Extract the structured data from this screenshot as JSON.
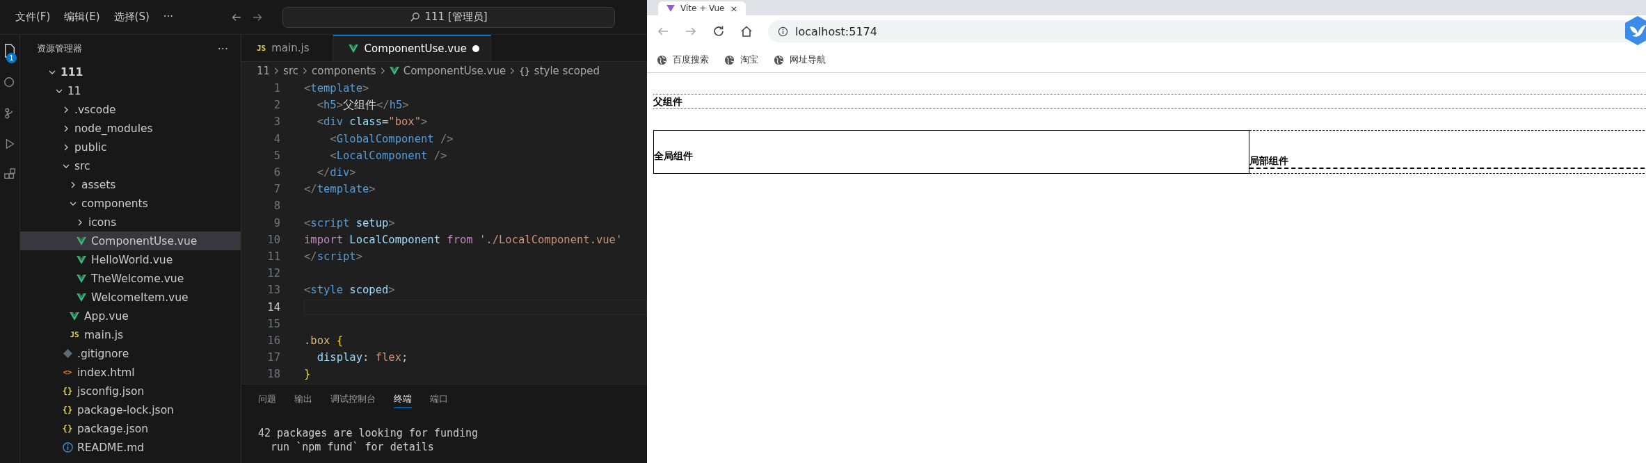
{
  "editor": {
    "menu": [
      "文件(F)",
      "编辑(E)",
      "选择(S)",
      "···"
    ],
    "command_center": "111 [管理员]",
    "explorer_badge": "1",
    "explorer": {
      "title": "资源管理器",
      "more": "···",
      "tree": [
        {
          "label": "111",
          "kind": "folder",
          "expanded": true,
          "selected": false,
          "children": [
            {
              "label": "11",
              "kind": "folder",
              "expanded": true,
              "selected": false,
              "children": [
                {
                  "label": ".vscode",
                  "kind": "folder",
                  "expanded": false,
                  "selected": false
                },
                {
                  "label": "node_modules",
                  "kind": "folder",
                  "expanded": false,
                  "selected": false
                },
                {
                  "label": "public",
                  "kind": "folder",
                  "expanded": false,
                  "selected": false
                },
                {
                  "label": "src",
                  "kind": "folder",
                  "expanded": true,
                  "selected": false,
                  "children": [
                    {
                      "label": "assets",
                      "kind": "folder",
                      "expanded": false,
                      "selected": false
                    },
                    {
                      "label": "components",
                      "kind": "folder",
                      "expanded": true,
                      "selected": false,
                      "children": [
                        {
                          "label": "icons",
                          "kind": "folder",
                          "expanded": false,
                          "selected": false
                        },
                        {
                          "label": "ComponentUse.vue",
                          "kind": "vue",
                          "selected": true
                        },
                        {
                          "label": "HelloWorld.vue",
                          "kind": "vue",
                          "selected": false
                        },
                        {
                          "label": "TheWelcome.vue",
                          "kind": "vue",
                          "selected": false
                        },
                        {
                          "label": "WelcomeItem.vue",
                          "kind": "vue",
                          "selected": false
                        }
                      ]
                    },
                    {
                      "label": "App.vue",
                      "kind": "vue",
                      "selected": false
                    },
                    {
                      "label": "main.js",
                      "kind": "js",
                      "icon": "JS",
                      "selected": false
                    }
                  ]
                },
                {
                  "label": ".gitignore",
                  "kind": "git",
                  "selected": false
                },
                {
                  "label": "index.html",
                  "kind": "html",
                  "icon": "<>",
                  "selected": false
                },
                {
                  "label": "jsconfig.json",
                  "kind": "json",
                  "icon": "{}",
                  "selected": false
                },
                {
                  "label": "package-lock.json",
                  "kind": "json",
                  "icon": "{}",
                  "selected": false
                },
                {
                  "label": "package.json",
                  "kind": "json",
                  "icon": "{}",
                  "selected": false
                },
                {
                  "label": "README.md",
                  "kind": "info",
                  "selected": false
                }
              ]
            }
          ]
        }
      ]
    },
    "tabs": [
      {
        "label": "main.js",
        "kind": "js",
        "icon": "JS",
        "selected": false,
        "modified": false
      },
      {
        "label": "ComponentUse.vue",
        "kind": "vue",
        "selected": true,
        "modified": true
      }
    ],
    "breadcrumbs": [
      {
        "label": "11",
        "kind": "plain"
      },
      {
        "label": "src",
        "kind": "plain"
      },
      {
        "label": "components",
        "kind": "plain"
      },
      {
        "label": "ComponentUse.vue",
        "kind": "vue"
      },
      {
        "label": "style scoped",
        "kind": "symbol",
        "icon": "{}"
      }
    ],
    "code": [
      {
        "number": "1",
        "current": false,
        "tokens": [
          {
            "text": "<",
            "kind": "p"
          },
          {
            "text": "template",
            "kind": "tag"
          },
          {
            "text": ">",
            "kind": "p"
          }
        ]
      },
      {
        "number": "2",
        "current": false,
        "tokens": [
          {
            "text": "  <",
            "kind": "p"
          },
          {
            "text": "h5",
            "kind": "tag"
          },
          {
            "text": ">",
            "kind": "p"
          },
          {
            "text": "父组件",
            "kind": "text"
          },
          {
            "text": "</",
            "kind": "p"
          },
          {
            "text": "h5",
            "kind": "tag"
          },
          {
            "text": ">",
            "kind": "p"
          }
        ]
      },
      {
        "number": "3",
        "current": false,
        "tokens": [
          {
            "text": "  <",
            "kind": "p"
          },
          {
            "text": "div",
            "kind": "tag"
          },
          {
            "text": " class",
            "kind": "attr"
          },
          {
            "text": "=",
            "kind": "text"
          },
          {
            "text": "\"box\"",
            "kind": "str"
          },
          {
            "text": ">",
            "kind": "p"
          }
        ]
      },
      {
        "number": "4",
        "current": false,
        "tokens": [
          {
            "text": "    <",
            "kind": "p"
          },
          {
            "text": "GlobalComponent",
            "kind": "tag"
          },
          {
            "text": " />",
            "kind": "p"
          }
        ]
      },
      {
        "number": "5",
        "current": false,
        "tokens": [
          {
            "text": "    <",
            "kind": "p"
          },
          {
            "text": "LocalComponent",
            "kind": "tag"
          },
          {
            "text": " />",
            "kind": "p"
          }
        ]
      },
      {
        "number": "6",
        "current": false,
        "tokens": [
          {
            "text": "  </",
            "kind": "p"
          },
          {
            "text": "div",
            "kind": "tag"
          },
          {
            "text": ">",
            "kind": "p"
          }
        ]
      },
      {
        "number": "7",
        "current": false,
        "tokens": [
          {
            "text": "</",
            "kind": "p"
          },
          {
            "text": "template",
            "kind": "tag"
          },
          {
            "text": ">",
            "kind": "p"
          }
        ]
      },
      {
        "number": "8",
        "current": false
      },
      {
        "number": "9",
        "current": false,
        "tokens": [
          {
            "text": "<",
            "kind": "p"
          },
          {
            "text": "script",
            "kind": "tag"
          },
          {
            "text": " setup",
            "kind": "attr"
          },
          {
            "text": ">",
            "kind": "p"
          }
        ]
      },
      {
        "number": "10",
        "current": false,
        "tokens": [
          {
            "text": "import",
            "kind": "kw"
          },
          {
            "text": " LocalComponent",
            "kind": "var"
          },
          {
            "text": " from",
            "kind": "kw"
          },
          {
            "text": " './LocalComponent.vue'",
            "kind": "str"
          }
        ]
      },
      {
        "number": "11",
        "current": false,
        "tokens": [
          {
            "text": "</",
            "kind": "p"
          },
          {
            "text": "script",
            "kind": "tag"
          },
          {
            "text": ">",
            "kind": "p"
          }
        ]
      },
      {
        "number": "12",
        "current": false
      },
      {
        "number": "13",
        "current": false,
        "tokens": [
          {
            "text": "<",
            "kind": "p"
          },
          {
            "text": "style",
            "kind": "tag"
          },
          {
            "text": " scoped",
            "kind": "attr"
          },
          {
            "text": ">",
            "kind": "p"
          }
        ]
      },
      {
        "number": "14",
        "current": true
      },
      {
        "number": "15",
        "current": false
      },
      {
        "number": "16",
        "current": false,
        "tokens": [
          {
            "text": ".box",
            "kind": "sel"
          },
          {
            "text": " {",
            "kind": "brace"
          }
        ]
      },
      {
        "number": "17",
        "current": false,
        "tokens": [
          {
            "text": "  display",
            "kind": "prop"
          },
          {
            "text": ":",
            "kind": "text"
          },
          {
            "text": " flex",
            "kind": "val"
          },
          {
            "text": ";",
            "kind": "text"
          }
        ]
      },
      {
        "number": "18",
        "current": false,
        "tokens": [
          {
            "text": "}",
            "kind": "brace"
          }
        ]
      }
    ],
    "panel_tabs": [
      {
        "label": "问题",
        "selected": false
      },
      {
        "label": "输出",
        "selected": false
      },
      {
        "label": "调试控制台",
        "selected": false
      },
      {
        "label": "终端",
        "selected": true
      },
      {
        "label": "端口",
        "selected": false
      }
    ],
    "terminal": [
      "42 packages are looking for funding",
      "  run `npm fund` for details"
    ]
  },
  "browser": {
    "tab": {
      "title": "Vite + Vue",
      "close": "×"
    },
    "address": "localhost:5174",
    "bookmarks": [
      "百度搜索",
      "淘宝",
      "网址导航"
    ],
    "page": {
      "heading": "父组件",
      "global_component": "全局组件",
      "local_component": "局部组件"
    }
  }
}
